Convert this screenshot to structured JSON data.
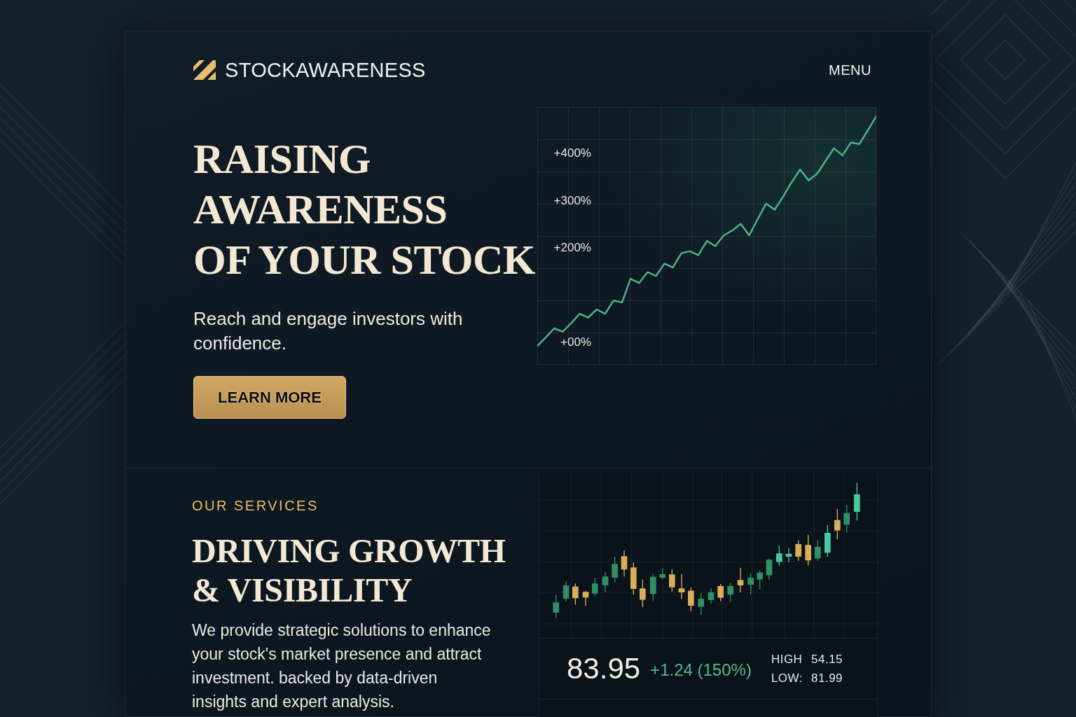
{
  "header": {
    "brand": "STOCKAWARENESS",
    "menu": "MENU"
  },
  "hero": {
    "title_lines": [
      "RAISING",
      "AWARENESS",
      "OF YOUR STOCK"
    ],
    "subtitle": "Reach and engage investors with confidence.",
    "cta": "LEARN MORE",
    "chart_data": {
      "type": "line",
      "categories": [
        null,
        null,
        null,
        null,
        null,
        null,
        null,
        null,
        null,
        null,
        null,
        null,
        null,
        null,
        null,
        null,
        null,
        null,
        null,
        null,
        null,
        null,
        null,
        null,
        null,
        null,
        null,
        null,
        null,
        null,
        null,
        null,
        null,
        null,
        null,
        null,
        null,
        null,
        null,
        null,
        null
      ],
      "values": [
        -6,
        12,
        31,
        24,
        42,
        62,
        54,
        71,
        62,
        90,
        86,
        136,
        127,
        150,
        142,
        168,
        160,
        190,
        194,
        186,
        216,
        205,
        228,
        238,
        252,
        228,
        262,
        295,
        282,
        310,
        340,
        367,
        344,
        358,
        385,
        412,
        397,
        424,
        421,
        450,
        480
      ],
      "ylim": [
        -46,
        499
      ],
      "yticks": [
        {
          "value": 400,
          "label": "+400%"
        },
        {
          "value": 300,
          "label": "+300%"
        },
        {
          "value": 200,
          "label": "+200%"
        },
        {
          "value": 0,
          "label": "+00%"
        }
      ],
      "grid": true
    }
  },
  "services": {
    "eyebrow": "OUR SERVICES",
    "title_lines": [
      "DRIVING GROWTH",
      "& VISIBILITY"
    ],
    "description_lines": [
      "We provide strategic solutions to enhance",
      "your stock's market presence and attract",
      "investment. backed by data-driven",
      "insights and expert analysis."
    ],
    "quote": {
      "price": "83.95",
      "change": "+1.24 (150%)",
      "stats": [
        {
          "label": "HIGH",
          "value": "54.15"
        },
        {
          "label": "LOW:",
          "value": "81.99"
        }
      ]
    }
  }
}
